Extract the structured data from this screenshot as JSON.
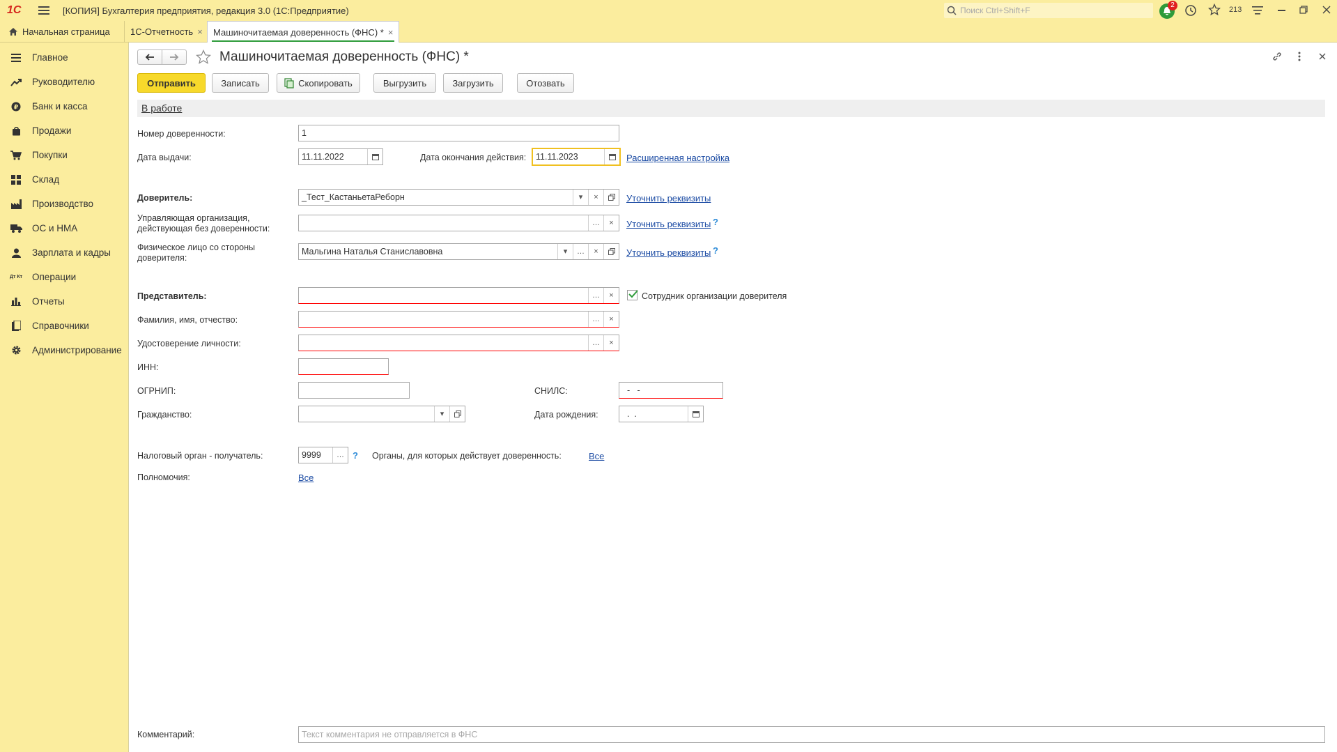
{
  "window": {
    "logo": "1С",
    "title": "[КОПИЯ] Бухгалтерия предприятия, редакция 3.0  (1С:Предприятие)",
    "search_placeholder": "Поиск Ctrl+Shift+F",
    "notifications_count": "2",
    "counter": "213"
  },
  "tabs": [
    {
      "label": "Начальная страница"
    },
    {
      "label": "1С-Отчетность"
    },
    {
      "label": "Машиночитаемая доверенность (ФНС) *"
    }
  ],
  "sidebar": {
    "items": [
      {
        "label": "Главное",
        "icon": "menu-icon"
      },
      {
        "label": "Руководителю",
        "icon": "trend-icon"
      },
      {
        "label": "Банк и касса",
        "icon": "coin-icon"
      },
      {
        "label": "Продажи",
        "icon": "bag-icon"
      },
      {
        "label": "Покупки",
        "icon": "cart-icon"
      },
      {
        "label": "Склад",
        "icon": "grid-icon"
      },
      {
        "label": "Производство",
        "icon": "factory-icon"
      },
      {
        "label": "ОС и НМА",
        "icon": "truck-icon"
      },
      {
        "label": "Зарплата и кадры",
        "icon": "person-icon"
      },
      {
        "label": "Операции",
        "icon": "dt-kt-icon",
        "icon_text": "Дт Кт"
      },
      {
        "label": "Отчеты",
        "icon": "bar-chart-icon"
      },
      {
        "label": "Справочники",
        "icon": "book-icon"
      },
      {
        "label": "Администрирование",
        "icon": "gear-icon"
      }
    ]
  },
  "form": {
    "title": "Машиночитаемая доверенность (ФНС) *",
    "buttons": {
      "send": "Отправить",
      "save": "Записать",
      "copy": "Скопировать",
      "export": "Выгрузить",
      "import": "Загрузить",
      "revoke": "Отозвать"
    },
    "status": "В работе",
    "fields": {
      "number_label": "Номер доверенности:",
      "number_value": "1",
      "issue_date_label": "Дата выдачи:",
      "issue_date_value": "11.11.2022",
      "end_date_label": "Дата окончания действия:",
      "end_date_value": "11.11.2023",
      "advanced_link": "Расширенная настройка",
      "principal_label": "Доверитель:",
      "principal_value": "_Тест_КастаньетаРеборн",
      "clarify_link": "Уточнить реквизиты",
      "managing_org_label_1": "Управляющая организация,",
      "managing_org_label_2": "действующая без доверенности:",
      "managing_org_value": "",
      "person_label_1": "Физическое лицо со стороны",
      "person_label_2": "доверителя:",
      "person_value": "Мальгина Наталья Станиславовна",
      "representative_label": "Представитель:",
      "employee_checkbox_label": "Сотрудник организации доверителя",
      "employee_checked": true,
      "fio_label": "Фамилия, имя, отчество:",
      "id_doc_label": "Удостоверение личности:",
      "inn_label": "ИНН:",
      "ogrnip_label": "ОГРНИП:",
      "snils_label": "СНИЛС:",
      "snils_value": "  -   -",
      "citizenship_label": "Гражданство:",
      "birth_date_label": "Дата рождения:",
      "birth_date_value": "  .  .",
      "tax_authority_label": "Налоговый орган - получатель:",
      "tax_authority_value": "9999",
      "bodies_label": "Органы, для которых действует доверенность:",
      "bodies_link": "Все",
      "powers_label": "Полномочия:",
      "powers_link": "Все",
      "comment_label": "Комментарий:",
      "comment_placeholder": "Текст комментария не отправляется в ФНС",
      "help_mark": "?"
    }
  },
  "colors": {
    "sidebar_bg": "#fbed9e",
    "primary_button": "#f7d92b",
    "link": "#1a4aa3",
    "required_underline": "#ff0000",
    "focus_border": "#f0c020",
    "checkbox_check": "#2e9b3a"
  }
}
